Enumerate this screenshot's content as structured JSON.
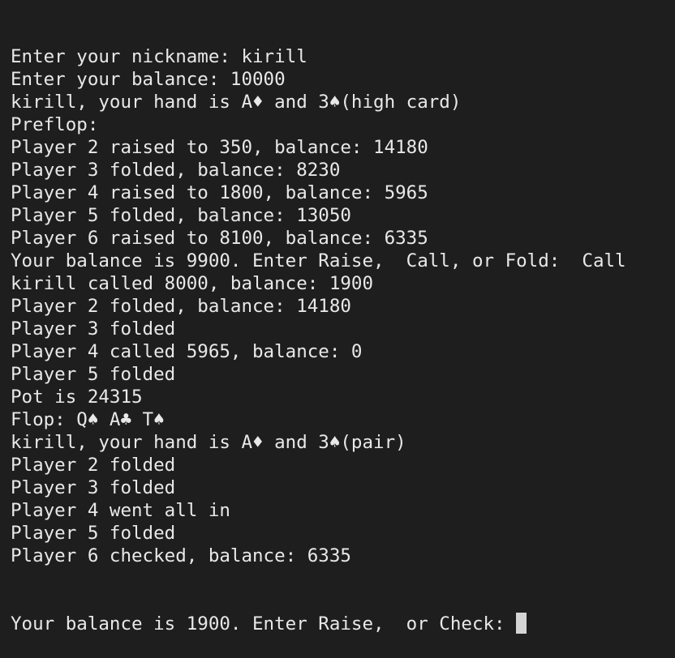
{
  "terminal": {
    "lines": [
      "Enter your nickname: kirill",
      "Enter your balance: 10000",
      "kirill, your hand is A♦ and 3♠(high card)",
      "Preflop:",
      "Player 2 raised to 350, balance: 14180",
      "Player 3 folded, balance: 8230",
      "Player 4 raised to 1800, balance: 5965",
      "Player 5 folded, balance: 13050",
      "Player 6 raised to 8100, balance: 6335",
      "Your balance is 9900. Enter Raise,  Call, or Fold:  Call",
      "kirill called 8000, balance: 1900",
      "Player 2 folded, balance: 14180",
      "Player 3 folded",
      "Player 4 called 5965, balance: 0",
      "Player 5 folded",
      "Pot is 24315",
      "Flop: Q♠ A♣ T♠",
      "kirill, your hand is A♦ and 3♠(pair)",
      "Player 2 folded",
      "Player 3 folded",
      "Player 4 went all in",
      "Player 5 folded",
      "Player 6 checked, balance: 6335"
    ],
    "prompt": "Your balance is 1900. Enter Raise,  or Check: ",
    "colors": {
      "background": "#1e1e1e",
      "text": "#e8e8e8",
      "cursor": "#d4d4d4"
    }
  }
}
